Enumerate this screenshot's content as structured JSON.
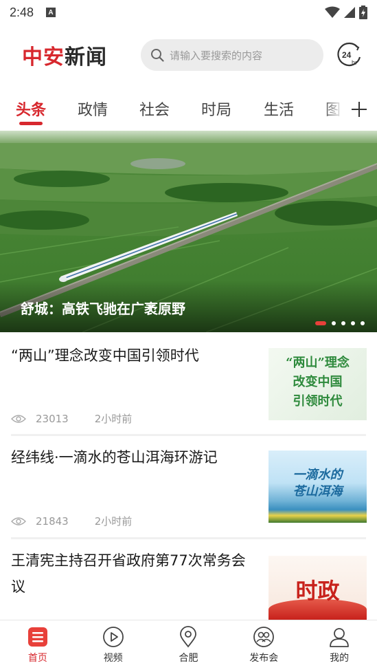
{
  "status_bar": {
    "time": "2:48",
    "notification_glyph": "A"
  },
  "header": {
    "logo_part1": "中安",
    "logo_part2": "新闻",
    "search_placeholder": "请输入要搜索的内容",
    "clock_label": "24",
    "clock_sub": "hr"
  },
  "tabs": [
    "头条",
    "政情",
    "社会",
    "时局",
    "生活",
    "图"
  ],
  "active_tab": 0,
  "hero": {
    "title": "舒城：高铁飞驰在广袤原野",
    "slide_count": 5,
    "active_slide": 0
  },
  "news": [
    {
      "title": "“两山”理念改变中国引领时代",
      "views": "23013",
      "time": "2小时前",
      "thumb_text": [
        "“两山”理念",
        "改变中国",
        "引领时代"
      ]
    },
    {
      "title": "经纬线·一滴水的苍山洱海环游记",
      "views": "21843",
      "time": "2小时前",
      "thumb_text": [
        "一滴水的",
        "苍山洱海"
      ]
    },
    {
      "title": "王清宪主持召开省政府第77次常务会议",
      "thumb_text": [
        "时政"
      ]
    }
  ],
  "bottom_nav": [
    {
      "label": "首页",
      "icon": "home-icon"
    },
    {
      "label": "视频",
      "icon": "video-icon"
    },
    {
      "label": "合肥",
      "icon": "location-icon"
    },
    {
      "label": "发布会",
      "icon": "people-icon"
    },
    {
      "label": "我的",
      "icon": "profile-icon"
    }
  ],
  "colors": {
    "accent": "#d7282e",
    "thumb_green": "#2e8a3c"
  }
}
